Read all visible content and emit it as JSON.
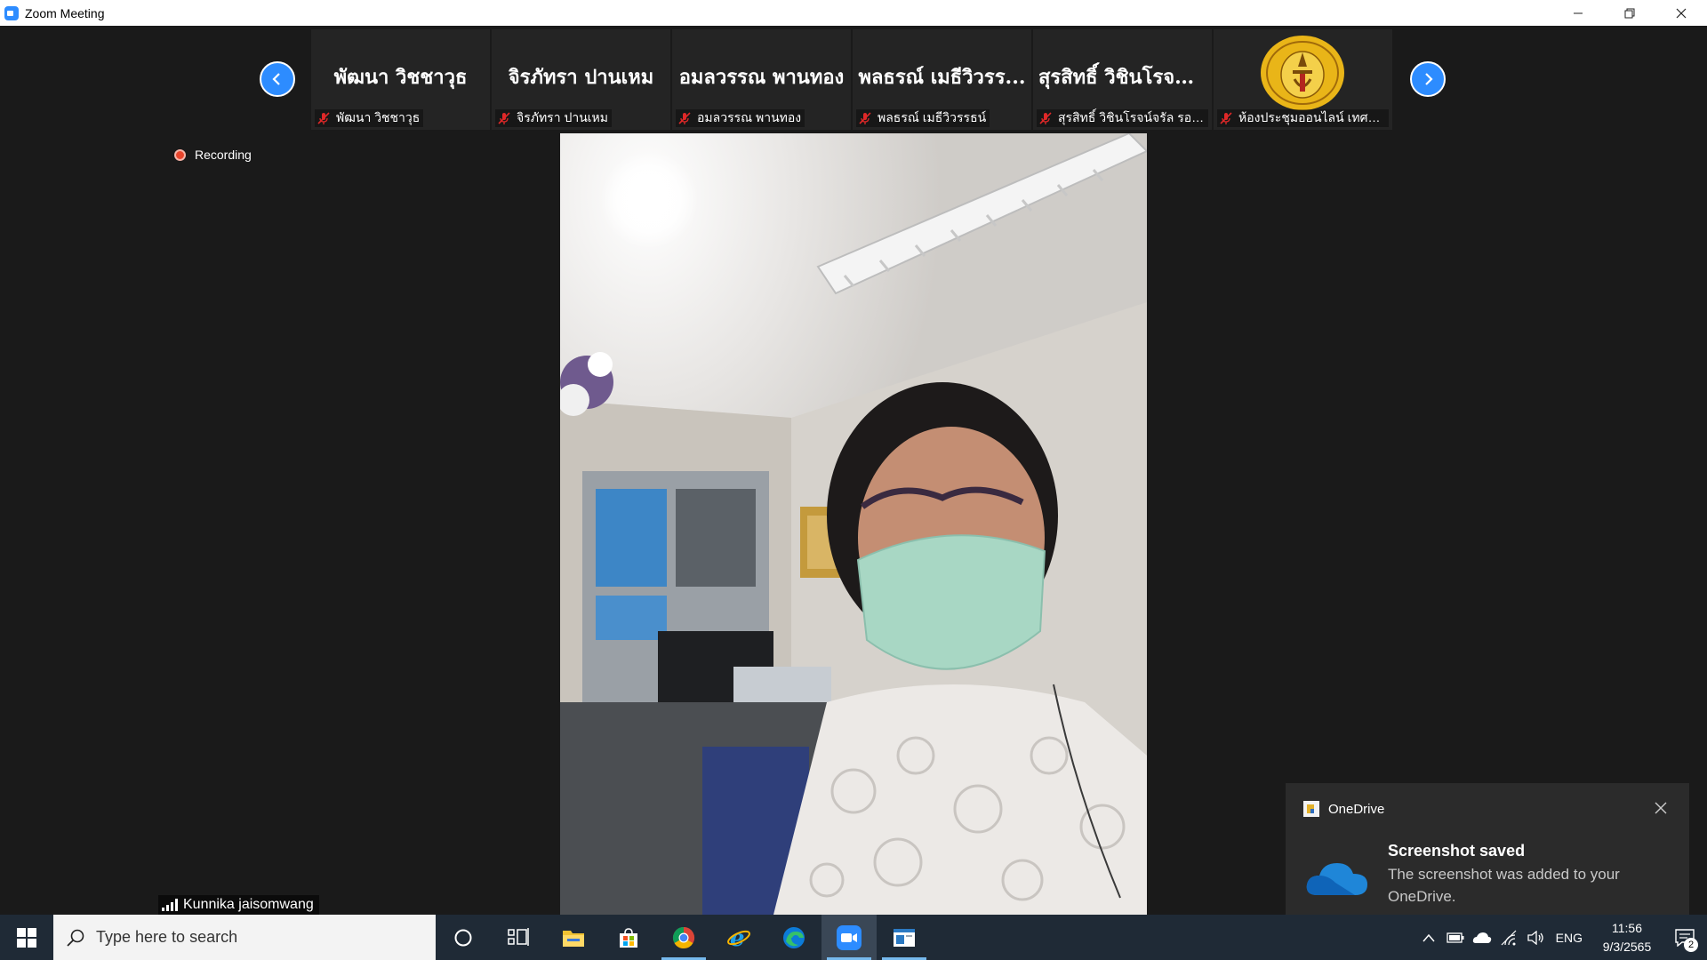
{
  "window": {
    "title": "Zoom Meeting",
    "controls": {
      "minimize": "—",
      "restore": "❐",
      "close": "✕"
    }
  },
  "gallery": {
    "tiles": [
      {
        "big_name": "พัฒนา วิชชาวุธ",
        "label": "พัฒนา วิชชาวุธ"
      },
      {
        "big_name": "จิรภัทรา ปานเหม",
        "label": "จิรภัทรา ปานเหม"
      },
      {
        "big_name": "อมลวรรณ พานทอง",
        "label": "อมลวรรณ พานทอง"
      },
      {
        "big_name": "พลธรณ์ เมธีวิวรร...",
        "label": "พลธรณ์ เมธีวิวรรธน์"
      },
      {
        "big_name": "สุรสิทธิ์ วิชินโรจน์...",
        "label": "สุรสิทธิ์ วิชินโรจน์จรัล รอง..."
      },
      {
        "big_name": "",
        "label": "ห้องประชุมออนไลน์ เทศบา..."
      }
    ]
  },
  "recording": {
    "label": "Recording"
  },
  "speaker": {
    "name": "Kunnika jaisomwang"
  },
  "toast": {
    "app": "OneDrive",
    "title": "Screenshot saved",
    "body": "The screenshot was added to your OneDrive."
  },
  "taskbar": {
    "search_placeholder": "Type here to search",
    "pinned": [
      "cortana-icon",
      "task-view-icon",
      "file-explorer-icon",
      "microsoft-store-icon",
      "chrome-icon",
      "internet-explorer-icon",
      "edge-icon",
      "zoom-icon",
      "app-window-icon"
    ],
    "language": "ENG",
    "time": "11:56",
    "date": "9/3/2565",
    "notification_count": "2"
  },
  "colors": {
    "accent": "#2d8cff",
    "recording": "#e8452c",
    "taskbar": "#1f2a36",
    "meeting_bg": "#1a1a1a"
  }
}
